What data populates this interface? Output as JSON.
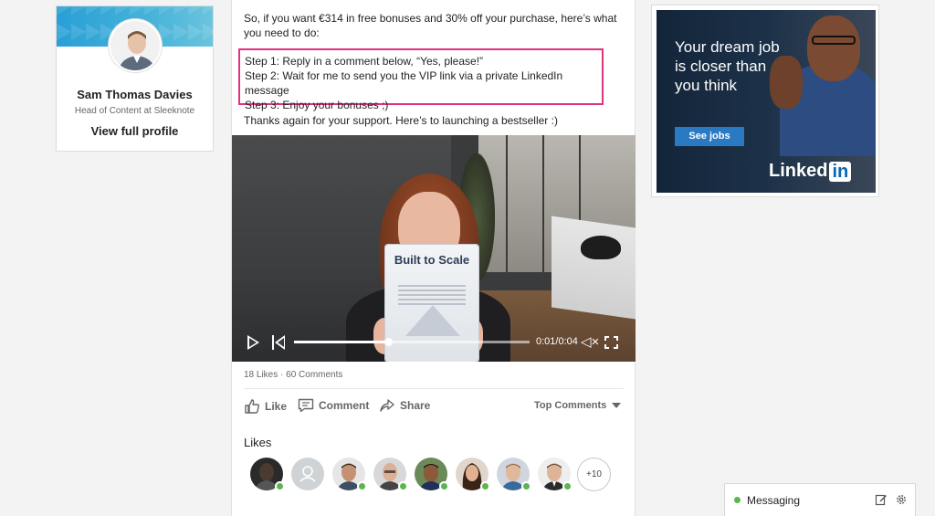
{
  "profile": {
    "name": "Sam Thomas Davies",
    "title": "Head of Content at Sleeknote",
    "view_link": "View full profile"
  },
  "post": {
    "intro": "So, if you want €314 in free bonuses and 30% off your purchase, here’s what you need to do:",
    "steps": [
      "Step 1: Reply in a comment below, “Yes, please!”",
      "Step 2: Wait for me to send you the VIP link via a private LinkedIn message",
      "Step 3: Enjoy your bonuses ;)"
    ],
    "thanks": "Thanks again for your support. Here’s to launching a bestseller :)",
    "highlight_color": "#e0327e"
  },
  "video": {
    "book_title": "Built to Scale",
    "time": "0:01/0:04",
    "progress": 0.4
  },
  "social": {
    "counts": "18 Likes · 60 Comments",
    "actions": {
      "like": "Like",
      "comment": "Comment",
      "share": "Share"
    },
    "sort": "Top Comments",
    "likes_heading": "Likes",
    "more_likes": "+10"
  },
  "ad": {
    "headline": "Your dream job is closer than you think",
    "button": "See jobs",
    "brand_prefix": "Linked",
    "brand_box": "in"
  },
  "messaging": {
    "label": "Messaging",
    "online_color": "#5bb550"
  }
}
